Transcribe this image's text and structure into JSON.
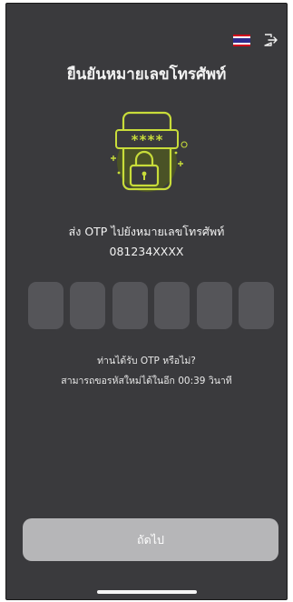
{
  "screen": {
    "title": "ยืนยันหมายเลขโทรศัพท์",
    "language_flag": "thai-flag-icon",
    "logout_icon": "logout-icon"
  },
  "otp_illustration": {
    "code_mask": "****",
    "icon": "otp-phone-lock-icon",
    "accent_color": "#c8dc3a"
  },
  "instructions": {
    "line1": "ส่ง OTP ไปยังหมายเลขโทรศัพท์",
    "phone_number": "081234XXXX"
  },
  "otp_input": {
    "digits": [
      "",
      "",
      "",
      "",
      "",
      ""
    ]
  },
  "resend": {
    "question": "ท่านได้รับ OTP หรือไม่?",
    "countdown_text": "สามารถขอรหัสใหม่ได้ในอีก 00:39 วินาที"
  },
  "actions": {
    "next_label": "ถัดไป"
  },
  "colors": {
    "background": "#3a3a3d",
    "otp_box": "#555559",
    "button_disabled": "#b6b6b8"
  }
}
